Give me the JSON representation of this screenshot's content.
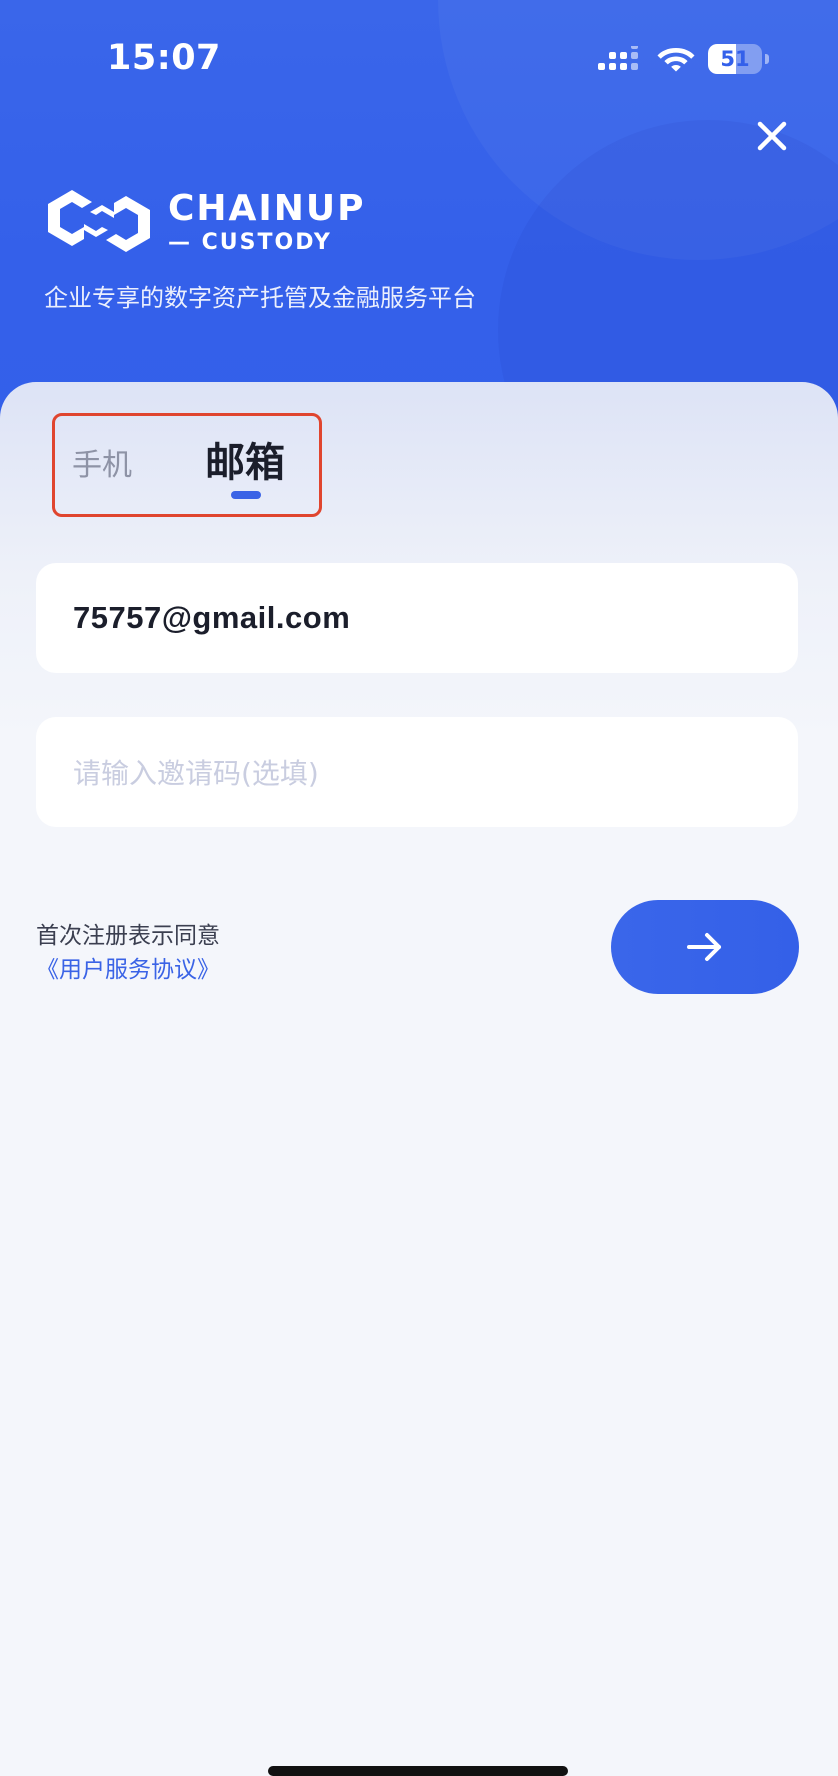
{
  "status_bar": {
    "time": "15:07",
    "battery_level": "51",
    "battery_fraction": 0.51,
    "icons": [
      "signal-icon",
      "wifi-icon",
      "battery-icon"
    ]
  },
  "header": {
    "close_icon": "close-icon",
    "brand_name": "CHAINUP",
    "brand_sub": "— CUSTODY",
    "tagline": "企业专享的数字资产托管及金融服务平台"
  },
  "tabs": {
    "phone_label": "手机",
    "email_label": "邮箱",
    "active": "email"
  },
  "form": {
    "email_value": "75757@gmail.com",
    "invite_placeholder": "请输入邀请码(选填)"
  },
  "agreement": {
    "text": "首次注册表示同意",
    "link_label": "《用户服务协议》"
  },
  "next_button": {
    "icon": "arrow-right-icon"
  },
  "colors": {
    "primary": "#3360ea",
    "tab_highlight_border": "#e0452f",
    "link": "#3a63e6",
    "background": "#f4f6fb"
  }
}
